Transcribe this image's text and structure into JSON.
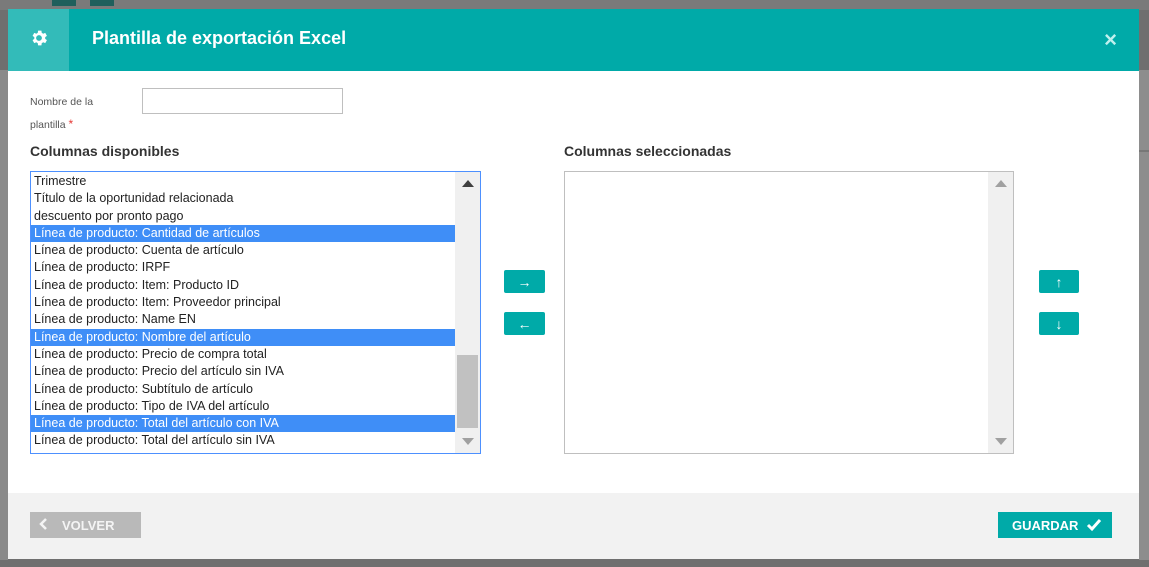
{
  "modal": {
    "title": "Plantilla de exportación Excel",
    "header_icon": "gear-icon",
    "close_icon": "×"
  },
  "form": {
    "name_label": "Nombre de la plantilla",
    "required_mark": "*",
    "name_value": ""
  },
  "available": {
    "title": "Columnas disponibles",
    "items": [
      {
        "label": "Trimestre",
        "selected": false
      },
      {
        "label": "Título de la oportunidad relacionada",
        "selected": false
      },
      {
        "label": "descuento por pronto pago",
        "selected": false
      },
      {
        "label": "Línea de producto: Cantidad de artículos",
        "selected": true
      },
      {
        "label": "Línea de producto: Cuenta de artículo",
        "selected": false
      },
      {
        "label": "Línea de producto: IRPF",
        "selected": false
      },
      {
        "label": "Línea de producto: Item: Producto ID",
        "selected": false
      },
      {
        "label": "Línea de producto: Item: Proveedor principal",
        "selected": false
      },
      {
        "label": "Línea de producto: Name EN",
        "selected": false
      },
      {
        "label": "Línea de producto: Nombre del artículo",
        "selected": true
      },
      {
        "label": "Línea de producto: Precio de compra total",
        "selected": false
      },
      {
        "label": "Línea de producto: Precio del artículo sin IVA",
        "selected": false
      },
      {
        "label": "Línea de producto: Subtítulo de artículo",
        "selected": false
      },
      {
        "label": "Línea de producto: Tipo de IVA del artículo",
        "selected": false
      },
      {
        "label": "Línea de producto: Total del artículo con IVA",
        "selected": true
      },
      {
        "label": "Línea de producto: Total del artículo sin IVA",
        "selected": false
      }
    ]
  },
  "selected": {
    "title": "Columnas seleccionadas",
    "items": []
  },
  "transfer": {
    "add": "→",
    "remove": "←",
    "up": "↑",
    "down": "↓"
  },
  "footer": {
    "back_label": "VOLVER",
    "save_label": "GUARDAR"
  },
  "colors": {
    "accent": "#00aaa8",
    "selection": "#3f8ef7",
    "back_button": "#b9b9b9"
  }
}
